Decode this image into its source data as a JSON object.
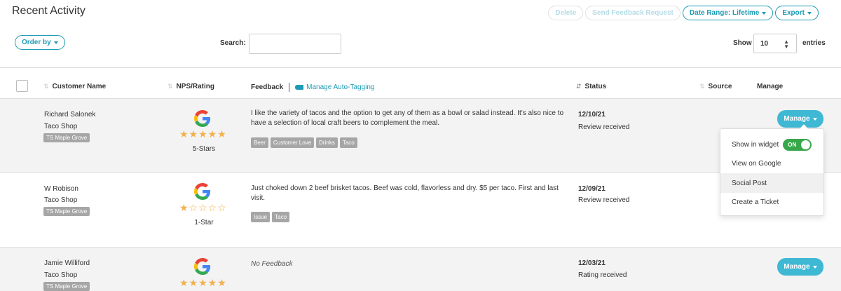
{
  "page": {
    "title": "Recent Activity"
  },
  "toolbar": {
    "delete_label": "Delete",
    "send_feedback_label": "Send Feedback Request",
    "date_range_label": "Date Range: Lifetime",
    "export_label": "Export"
  },
  "controls": {
    "order_by_label": "Order by",
    "search_label": "Search:",
    "search_value": "",
    "show_label": "Show",
    "entries_value": "10",
    "entries_label": "entries"
  },
  "table": {
    "headers": {
      "customer_name": "Customer Name",
      "nps_rating": "NPS/Rating",
      "feedback": "Feedback",
      "manage_auto_tagging": "Manage Auto-Tagging",
      "status": "Status",
      "source": "Source",
      "manage": "Manage"
    },
    "rows": [
      {
        "name": "Richard Salonek",
        "business": "Taco Shop",
        "location": "TS Maple Grove",
        "source_icon": "google-icon",
        "rating_stars": 5,
        "stars_text": "★★★★★",
        "rating_label": "5-Stars",
        "feedback": "I like the variety of tacos and the option to get any of them as a bowl or salad instead. It's also nice to have a selection of local craft beers to complement the meal.",
        "tags": [
          "Beer",
          "Customer Love",
          "Drinks",
          "Taco"
        ],
        "date": "12/10/21",
        "status": "Review received",
        "manage_label": "Manage"
      },
      {
        "name": "W Robison",
        "business": "Taco Shop",
        "location": "TS Maple Grove",
        "source_icon": "google-icon",
        "rating_stars": 1,
        "stars_text": "★☆☆☆☆",
        "rating_label": "1-Star",
        "feedback": "Just choked down 2 beef brisket tacos. Beef was cold, flavorless and dry. $5 per taco. First and last visit.",
        "tags": [
          "Issue",
          "Taco"
        ],
        "date": "12/09/21",
        "status": "Review received",
        "manage_label": "Manage"
      },
      {
        "name": "Jamie Williford",
        "business": "Taco Shop",
        "location": "TS Maple Grove",
        "source_icon": "google-icon",
        "rating_stars": 5,
        "stars_text": "★★★★★",
        "rating_label": "",
        "feedback": "No Feedback",
        "tags": [],
        "date": "12/03/21",
        "status": "Rating received",
        "manage_label": "Manage"
      }
    ]
  },
  "manage_menu": {
    "show_in_widget_label": "Show in widget",
    "toggle_label": "ON",
    "view_on_google_label": "View on Google",
    "social_post_label": "Social Post",
    "create_ticket_label": "Create a Ticket"
  },
  "colors": {
    "accent": "#1d9bb4",
    "manage_button": "#3fb8d4",
    "toggle_on": "#37a84a",
    "star": "#f3b04d",
    "tag_bg": "#a6a6a6"
  }
}
